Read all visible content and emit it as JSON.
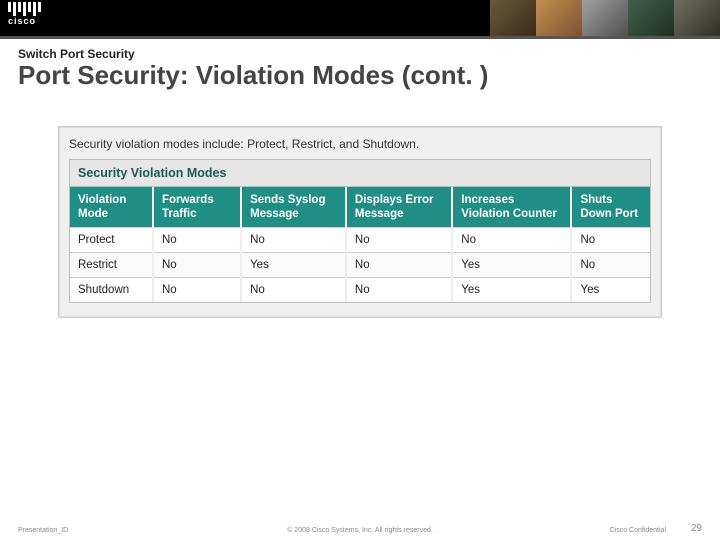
{
  "header": {
    "brand": "cisco",
    "kicker": "Switch Port Security",
    "title": "Port Security: Violation Modes (cont. )"
  },
  "panel": {
    "intro": "Security violation modes include: Protect, Restrict, and Shutdown.",
    "caption": "Security Violation Modes",
    "columns": [
      "Violation Mode",
      "Forwards Traffic",
      "Sends Syslog Message",
      "Displays Error Message",
      "Increases Violation Counter",
      "Shuts Down Port"
    ],
    "rows": [
      {
        "c0": "Protect",
        "c1": "No",
        "c2": "No",
        "c3": "No",
        "c4": "No",
        "c5": "No"
      },
      {
        "c0": "Restrict",
        "c1": "No",
        "c2": "Yes",
        "c3": "No",
        "c4": "Yes",
        "c5": "No"
      },
      {
        "c0": "Shutdown",
        "c1": "No",
        "c2": "No",
        "c3": "No",
        "c4": "Yes",
        "c5": "Yes"
      }
    ]
  },
  "footer": {
    "left": "Presentation_ID",
    "center": "© 2008 Cisco Systems, Inc. All rights reserved.",
    "confidential": "Cisco Confidential",
    "page": "29"
  }
}
